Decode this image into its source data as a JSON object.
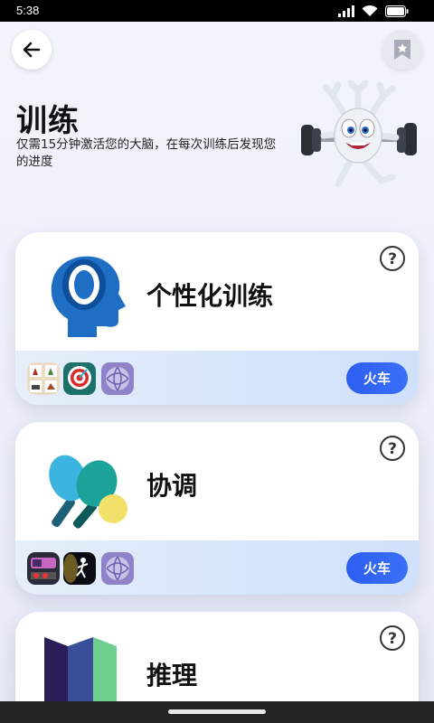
{
  "status_bar": {
    "time": "5:38"
  },
  "header": {
    "title": "训练",
    "subtitle": "仅需15分钟激活您的大脑，在每次训练后发现您的进度"
  },
  "cards": [
    {
      "title": "个性化训练",
      "button": "火车",
      "icon": "head-silhouette-icon",
      "thumbnails": [
        "animals-matching-thumb",
        "target-darts-thumb",
        "yarn-ball-thumb"
      ]
    },
    {
      "title": "协调",
      "button": "火车",
      "icon": "ping-pong-paddles-icon",
      "thumbnails": [
        "arcade-machine-thumb",
        "runner-night-thumb",
        "yarn-ball-thumb"
      ]
    },
    {
      "title": "推理",
      "icon": "folded-map-icon"
    }
  ],
  "colors": {
    "accent": "#2d5ef0",
    "background": "#eef0fa"
  }
}
